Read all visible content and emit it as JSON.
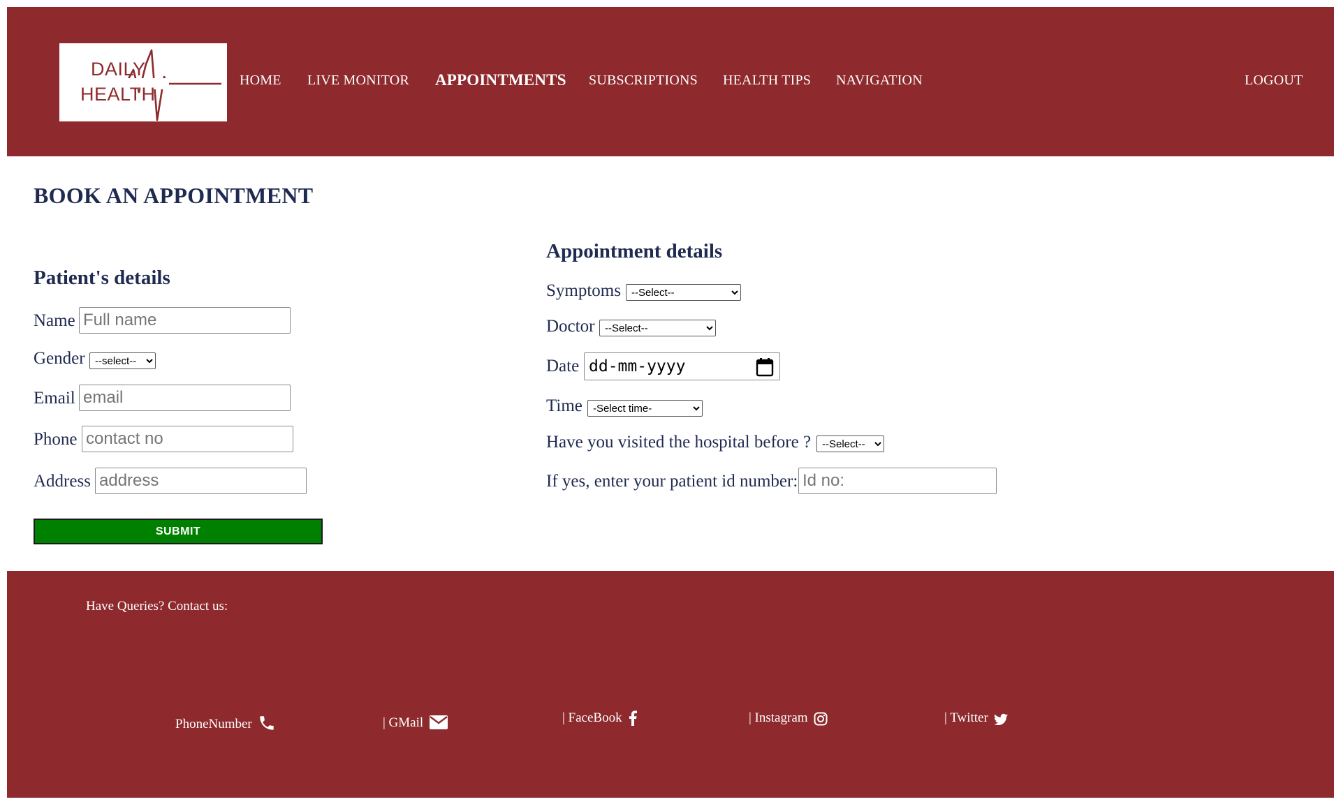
{
  "header": {
    "logo": {
      "line1": "DAILY",
      "line2": "HEALTH"
    },
    "nav": [
      {
        "label": "HOME",
        "active": false
      },
      {
        "label": "LIVE MONITOR",
        "active": false
      },
      {
        "label": "APPOINTMENTS",
        "active": true
      },
      {
        "label": "SUBSCRIPTIONS",
        "active": false
      },
      {
        "label": "HEALTH TIPS",
        "active": false
      },
      {
        "label": "NAVIGATION",
        "active": false
      }
    ],
    "logout_label": "LOGOUT"
  },
  "main": {
    "title": "BOOK AN APPOINTMENT",
    "patient": {
      "heading": "Patient's details",
      "name_label": "Name",
      "name_placeholder": "Full name",
      "gender_label": "Gender",
      "gender_value": "--select--",
      "email_label": "Email",
      "email_placeholder": "email",
      "phone_label": "Phone",
      "phone_placeholder": "contact no",
      "address_label": "Address",
      "address_placeholder": "address",
      "submit_label": "SUBMIT"
    },
    "appointment": {
      "heading": "Appointment details",
      "symptoms_label": "Symptoms",
      "symptoms_value": "--Select--",
      "doctor_label": "Doctor",
      "doctor_value": "--Select--",
      "date_label": "Date",
      "date_placeholder": "dd-mm-yyyy",
      "time_label": "Time",
      "time_value": "-Select time-",
      "visited_label": "Have you visited the hospital before ?",
      "visited_value": "--Select--",
      "patient_id_label": "If yes, enter your patient id number:",
      "patient_id_placeholder": "Id no:"
    }
  },
  "footer": {
    "title": "Have Queries? Contact us:",
    "links": [
      {
        "label": "PhoneNumber",
        "icon": "phone-icon"
      },
      {
        "label": "| GMail",
        "icon": "mail-icon"
      },
      {
        "label": "| FaceBook",
        "icon": "facebook-icon"
      },
      {
        "label": "| Instagram",
        "icon": "instagram-icon"
      },
      {
        "label": "| Twitter",
        "icon": "twitter-icon"
      }
    ]
  },
  "colors": {
    "brand": "#8e2a2d",
    "heading": "#1f2a50",
    "submit": "#008000"
  }
}
